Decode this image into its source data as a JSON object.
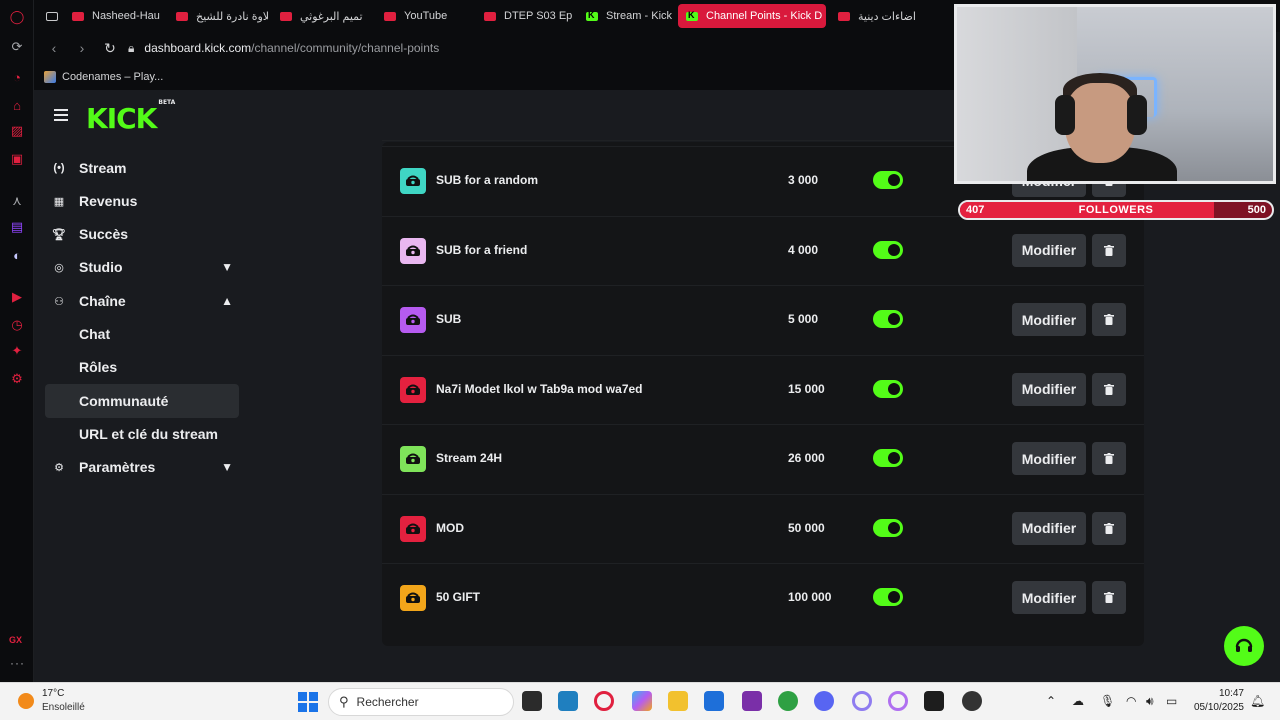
{
  "browser": {
    "tabs": [
      {
        "label": "Nasheed-Hau",
        "icon": "youtube-icon"
      },
      {
        "label": "تلاوة نادرة للشيخ",
        "icon": "youtube-icon"
      },
      {
        "label": "تميم البرغوثي",
        "icon": "youtube-icon"
      },
      {
        "label": "YouTube",
        "icon": "youtube-icon"
      },
      {
        "label": "DTEP S03 Ep",
        "icon": "youtube-icon"
      },
      {
        "label": "Stream - Kick",
        "icon": "kick-icon"
      },
      {
        "label": "Channel Points - Kick D",
        "icon": "kick-icon",
        "active": true
      },
      {
        "label": "اضاءات دينية",
        "icon": "youtube-icon"
      }
    ],
    "url_host": "dashboard.kick.com",
    "url_path": "/channel/community/channel-points",
    "bookmark": "Codenames – Play..."
  },
  "sidebar": {
    "items": [
      {
        "label": "Stream",
        "icon": "broadcast-icon"
      },
      {
        "label": "Revenus",
        "icon": "revenue-icon"
      },
      {
        "label": "Succès",
        "icon": "trophy-icon"
      },
      {
        "label": "Studio",
        "icon": "studio-icon",
        "expandable": true,
        "expanded": false
      },
      {
        "label": "Chaîne",
        "icon": "channel-icon",
        "expandable": true,
        "expanded": true
      },
      {
        "label": "Chat"
      },
      {
        "label": "Rôles"
      },
      {
        "label": "Communauté",
        "selected": true
      },
      {
        "label": "URL et clé du stream"
      },
      {
        "label": "Paramètres",
        "icon": "gear-icon",
        "expandable": true,
        "expanded": false
      }
    ]
  },
  "rewards": {
    "edit_label": "Modifier",
    "items": [
      {
        "name": "SUB for a random",
        "cost": "3 000",
        "enabled": true,
        "color": "#3fd6c4"
      },
      {
        "name": "SUB for a friend",
        "cost": "4 000",
        "enabled": true,
        "color": "#e9b7f0"
      },
      {
        "name": "SUB",
        "cost": "5 000",
        "enabled": true,
        "color": "#b65bf0"
      },
      {
        "name": "Na7i Modet lkol w Tab9a mod wa7ed",
        "cost": "15 000",
        "enabled": true,
        "color": "#e4213f"
      },
      {
        "name": "Stream 24H",
        "cost": "26 000",
        "enabled": true,
        "color": "#7fe35a"
      },
      {
        "name": "MOD",
        "cost": "50 000",
        "enabled": true,
        "color": "#e4213f"
      },
      {
        "name": "50 GIFT",
        "cost": "100 000",
        "enabled": true,
        "color": "#f2a51a"
      }
    ]
  },
  "overlay": {
    "followers_current": "407",
    "followers_label": "FOLLOWERS",
    "followers_goal": "500",
    "progress": 0.814,
    "partial_edit_label": "Modifier"
  },
  "taskbar": {
    "temp": "17°C",
    "condition": "Ensoleillé",
    "search_placeholder": "Rechercher",
    "time": "10:47",
    "date": "05/10/2025"
  },
  "colors": {
    "kick_green": "#53fc18",
    "opera_red": "#e0203f"
  }
}
